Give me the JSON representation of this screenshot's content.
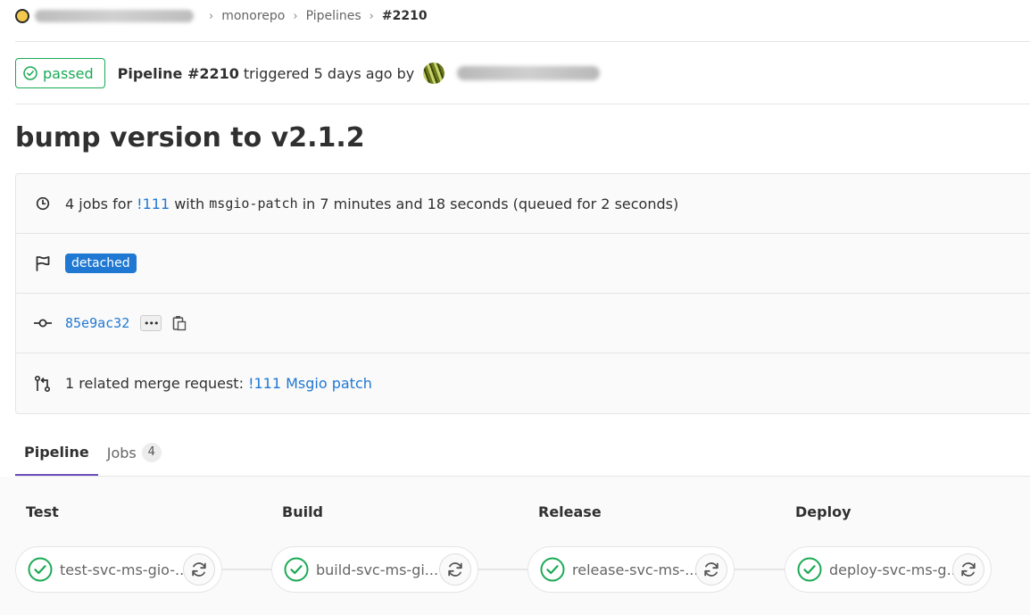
{
  "breadcrumb": {
    "project_icon": "project-avatar-icon",
    "items": [
      "monorepo",
      "Pipelines"
    ],
    "current": "#2210"
  },
  "header": {
    "status": "passed",
    "status_color": "#1aaa55",
    "pipeline_label": "Pipeline #2210",
    "triggered_text": "triggered 5 days ago by"
  },
  "title": "bump version to v2.1.2",
  "info": {
    "jobs_prefix": "4 jobs for",
    "mr_ref": "!111",
    "with_text": "with",
    "branch": "msgio-patch",
    "duration_text": "in 7 minutes and 18 seconds (queued for 2 seconds)",
    "tag": "detached",
    "commit_sha": "85e9ac32",
    "related_prefix": "1 related merge request:",
    "related_mr": "!111 Msgio patch"
  },
  "tabs": [
    {
      "label": "Pipeline",
      "active": true
    },
    {
      "label": "Jobs",
      "count": "4",
      "active": false
    }
  ],
  "stages": [
    {
      "name": "Test",
      "job": "test-svc-ms-gio-..."
    },
    {
      "name": "Build",
      "job": "build-svc-ms-gi..."
    },
    {
      "name": "Release",
      "job": "release-svc-ms-..."
    },
    {
      "name": "Deploy",
      "job": "deploy-svc-ms-g..."
    }
  ],
  "colors": {
    "accent": "#1f78d1",
    "success": "#1aaa55",
    "tab_active": "#6b4fbb"
  }
}
